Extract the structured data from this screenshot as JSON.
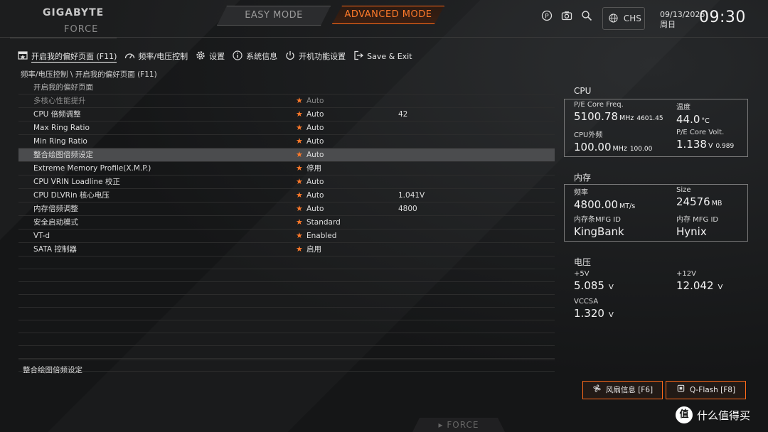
{
  "header": {
    "brand": "GIGABYTE",
    "sub_brand": "FORCE",
    "modes": {
      "easy": "EASY MODE",
      "advanced": "ADVANCED MODE"
    },
    "language": "CHS",
    "date": "09/13/2026",
    "weekday": "周日",
    "time": "09:30"
  },
  "nav": {
    "tabs": [
      {
        "label": "开启我的偏好页面 (F11)",
        "icon": "favorites-icon",
        "active": true
      },
      {
        "label": "频率/电压控制",
        "icon": "speedometer-icon"
      },
      {
        "label": "设置",
        "icon": "gear-icon"
      },
      {
        "label": "系统信息",
        "icon": "info-icon"
      },
      {
        "label": "开机功能设置",
        "icon": "power-icon"
      },
      {
        "label": "Save & Exit",
        "icon": "exit-icon"
      }
    ]
  },
  "breadcrumb": "频率/电压控制 \\ 开启我的偏好页面 (F11)",
  "settings": {
    "header": "开启我的偏好页面",
    "rows": [
      {
        "name": "多核心性能提升",
        "value": "Auto",
        "extra": ""
      },
      {
        "name": "CPU 倍频调整",
        "value": "Auto",
        "extra": "42"
      },
      {
        "name": "Max Ring Ratio",
        "value": "Auto",
        "extra": ""
      },
      {
        "name": "Min Ring Ratio",
        "value": "Auto",
        "extra": ""
      },
      {
        "name": "整合绘图倍频设定",
        "value": "Auto",
        "extra": ""
      },
      {
        "name": "Extreme Memory Profile(X.M.P.)",
        "value": "停用",
        "extra": ""
      },
      {
        "name": "CPU VRIN Loadline 校正",
        "value": "Auto",
        "extra": ""
      },
      {
        "name": "CPU DLVRin 核心电压",
        "value": "Auto",
        "extra": "1.041V"
      },
      {
        "name": "内存倍频调整",
        "value": "Auto",
        "extra": "4800"
      },
      {
        "name": "安全启动模式",
        "value": "Standard",
        "extra": ""
      },
      {
        "name": "VT-d",
        "value": "Enabled",
        "extra": ""
      },
      {
        "name": "SATA 控制器",
        "value": "启用",
        "extra": ""
      }
    ],
    "help_text": "整合绘图倍频设定"
  },
  "cpu": {
    "title": "CPU",
    "freq_label": "P/E Core Freq.",
    "freq_value": "5100.78",
    "freq_unit": "MHz",
    "freq_sub": "4601.45",
    "temp_label": "温度",
    "temp_value": "44.0",
    "temp_unit": "°C",
    "bclk_label": "CPU外频",
    "bclk_value": "100.00",
    "bclk_unit": "MHz",
    "bclk_sub": "100.00",
    "volt_label": "P/E Core Volt.",
    "volt_value": "1.138",
    "volt_unit": "V",
    "volt_sub": "0.989"
  },
  "memory": {
    "title": "内存",
    "freq_label": "频率",
    "freq_value": "4800.00",
    "freq_unit": "MT/s",
    "size_label": "Size",
    "size_value": "24576",
    "size_unit": "MB",
    "stick_mfg_label": "内存条MFG ID",
    "stick_mfg_value": "KingBank",
    "chip_mfg_label": "内存 MFG ID",
    "chip_mfg_value": "Hynix"
  },
  "voltage": {
    "title": "电压",
    "v5_label": "+5V",
    "v5_value": "5.085",
    "v12_label": "+12V",
    "v12_value": "12.042",
    "vccsa_label": "VCCSA",
    "vccsa_value": "1.320",
    "unit": "V"
  },
  "buttons": {
    "fan": "风扇信息 [F6]",
    "qflash": "Q-Flash [F8]"
  },
  "footer": {
    "force": "FORCE"
  },
  "watermark": {
    "badge": "值",
    "text": "什么值得买"
  },
  "colors": {
    "accent": "#ff6a1a",
    "star": "#ff7a2a",
    "selected_row": "#4b4c4e"
  }
}
